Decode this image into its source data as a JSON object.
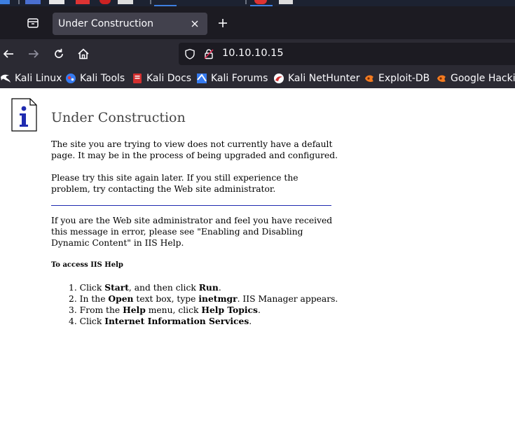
{
  "colors": {
    "taskbar_bg": "#1c2231",
    "tabstrip_bg": "#1c1b22",
    "active_tab_bg": "#42414d",
    "toolbar_bg": "#2b2a33",
    "urlbar_bg": "#1c1b22",
    "divider": "#1f2bb0"
  },
  "browser": {
    "tab": {
      "title": "Under Construction"
    },
    "address": {
      "url": "10.10.10.15"
    }
  },
  "bookmarks": [
    {
      "label": "Kali Linux",
      "icon": "kali-dragon-icon"
    },
    {
      "label": "Kali Tools",
      "icon": "kali-tools-icon"
    },
    {
      "label": "Kali Docs",
      "icon": "kali-docs-icon"
    },
    {
      "label": "Kali Forums",
      "icon": "kali-forums-icon"
    },
    {
      "label": "Kali NetHunter",
      "icon": "kali-nethunter-icon"
    },
    {
      "label": "Exploit-DB",
      "icon": "exploit-db-icon"
    },
    {
      "label": "Google Hacking",
      "icon": "google-hacking-icon"
    }
  ],
  "page": {
    "title": "Under Construction",
    "para1": "The site you are trying to view does not currently have a default page. It may be in the process of being upgraded and configured.",
    "para2": "Please try this site again later. If you still experience the problem, try contacting the Web site administrator.",
    "para3": "If you are the Web site administrator and feel you have received this message in error, please see \"Enabling and Disabling Dynamic Content\" in IIS Help.",
    "help_heading": "To access IIS Help",
    "steps": [
      {
        "num": "1.",
        "parts": [
          "Click ",
          "Start",
          ", and then click ",
          "Run",
          "."
        ]
      },
      {
        "num": "2.",
        "parts": [
          "In the ",
          "Open",
          " text box, type ",
          "inetmgr",
          ". IIS Manager appears."
        ]
      },
      {
        "num": "3.",
        "parts": [
          "From the ",
          "Help",
          " menu, click ",
          "Help Topics",
          "."
        ]
      },
      {
        "num": "4.",
        "parts": [
          "Click ",
          "Internet Information Services",
          "."
        ]
      }
    ]
  }
}
